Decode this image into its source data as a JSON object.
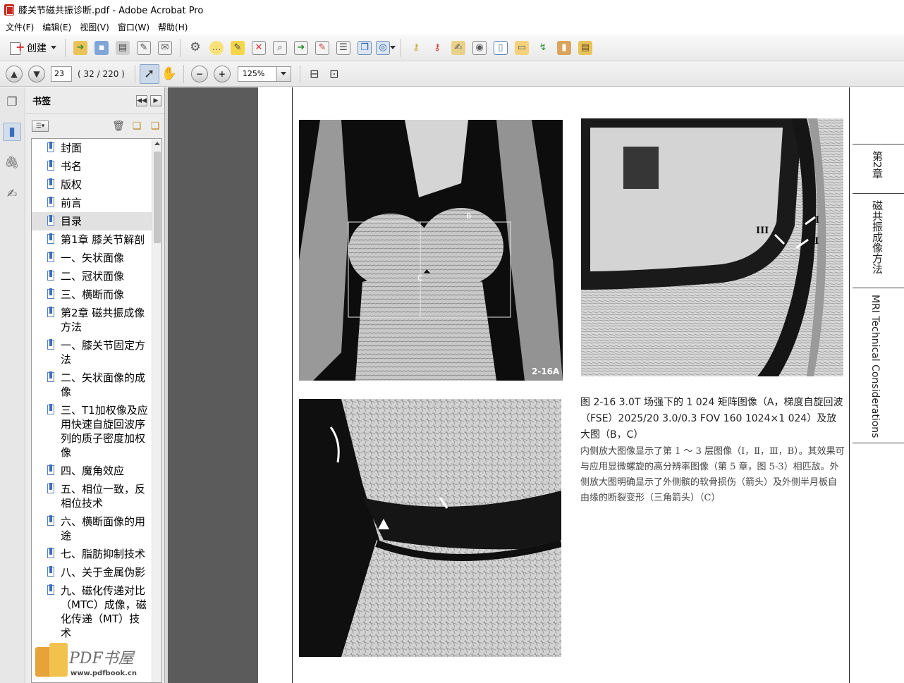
{
  "window": {
    "title": "膝关节磁共振诊断.pdf - Adobe Acrobat Pro"
  },
  "menu": [
    "文件(F)",
    "编辑(E)",
    "视图(V)",
    "窗口(W)",
    "帮助(H)"
  ],
  "toolbar": {
    "create_label": "创建"
  },
  "nav": {
    "page_value": "23",
    "page_count": "( 32 / 220 )",
    "zoom_value": "125%"
  },
  "bookmarks": {
    "header": "书签",
    "items": [
      {
        "label": "封面"
      },
      {
        "label": "书名"
      },
      {
        "label": "版权"
      },
      {
        "label": "前言"
      },
      {
        "label": "目录"
      },
      {
        "label": "第1章  膝关节解剖"
      },
      {
        "label": "  一、矢状面像"
      },
      {
        "label": "  二、冠状面像"
      },
      {
        "label": "  三、横断而像"
      },
      {
        "label": "第2章  磁共振成像方法"
      },
      {
        "label": "  一、膝关节固定方法"
      },
      {
        "label": "  二、矢状面像的成像"
      },
      {
        "label": "  三、T1加权像及应用快速自旋回波序列的质子密度加权像"
      },
      {
        "label": "  四、魔角效应"
      },
      {
        "label": "  五、相位一致，反相位技术"
      },
      {
        "label": "  六、横断面像的用途"
      },
      {
        "label": "  七、脂肪抑制技术"
      },
      {
        "label": "  八、关于金属伪影"
      },
      {
        "label": "  九、磁化传递对比（MTC）成像，磁化传递（MT）技术"
      }
    ]
  },
  "document": {
    "side_tabs": [
      "第2章",
      "磁共振成像方法",
      "MRI Technical Considerations"
    ],
    "figure_label": "2-16A",
    "marks": {
      "a_box_label": "B",
      "a_box_label2": "C",
      "roman1": "I",
      "roman2": "II",
      "roman3": "III"
    },
    "caption_title": "图 2-16  3.0T 场强下的 1 024 矩阵图像（A，梯度自旋回波（FSE）2025/20 3.0/0.3 FOV 160 1024×1 024）及放大图（B，C）",
    "caption_body": "内侧放大图像显示了第 1 ～ 3 层图像（Ⅰ，Ⅱ，Ⅲ，B）。其效果可与应用显微螺旋的高分辨率图像（第 5 章，图 5-3）相匹敌。外侧放大图明确显示了外侧髌的软骨损伤（箭头）及外侧半月板自由缘的断裂变形（三角箭头）（C）"
  },
  "watermark": {
    "text": "PDF书屋",
    "url": "www.pdfbook.cn"
  }
}
